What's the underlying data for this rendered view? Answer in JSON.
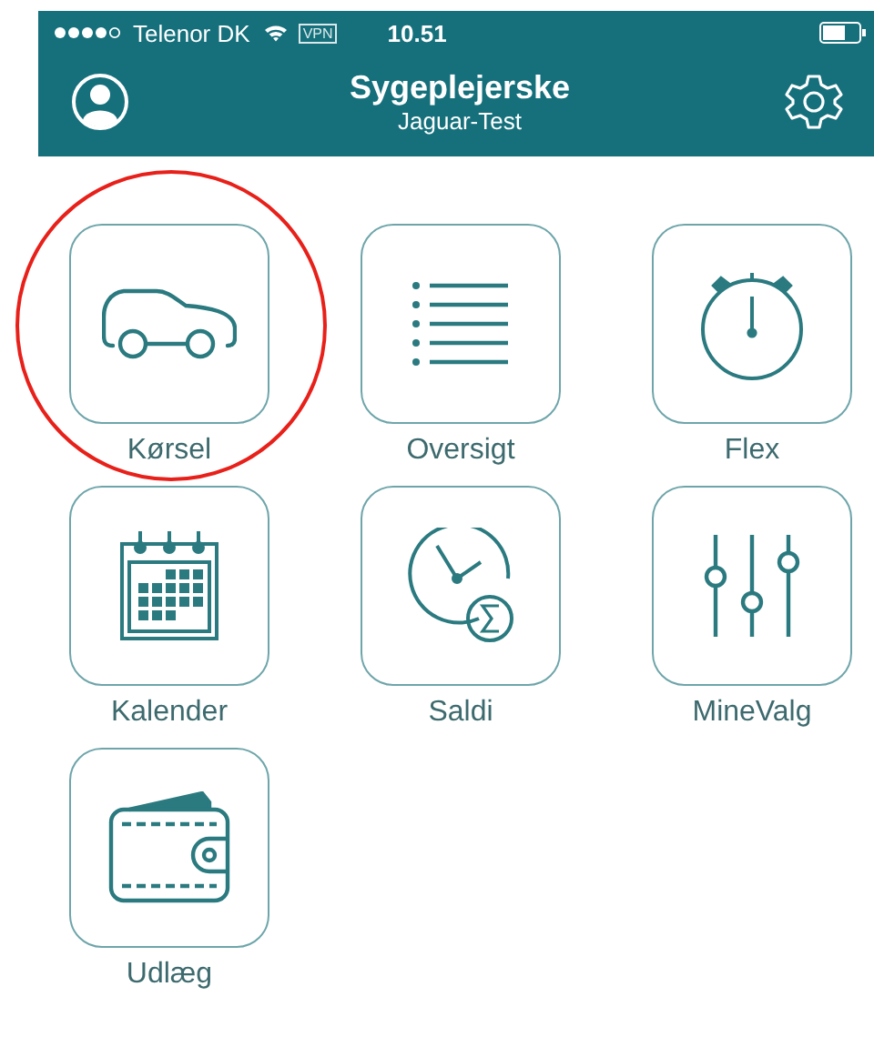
{
  "status_bar": {
    "carrier": "Telenor DK",
    "vpn": "VPN",
    "time": "10.51"
  },
  "nav": {
    "title": "Sygeplejerske",
    "subtitle": "Jaguar-Test"
  },
  "tiles": [
    {
      "label": "Kørsel",
      "kind": "car",
      "highlighted": true
    },
    {
      "label": "Oversigt",
      "kind": "list",
      "highlighted": false
    },
    {
      "label": "Flex",
      "kind": "stopwatch",
      "highlighted": false
    },
    {
      "label": "Kalender",
      "kind": "calendar",
      "highlighted": false
    },
    {
      "label": "Saldi",
      "kind": "clock-sum",
      "highlighted": false
    },
    {
      "label": "MineValg",
      "kind": "sliders",
      "highlighted": false
    },
    {
      "label": "Udlæg",
      "kind": "wallet",
      "highlighted": false
    }
  ]
}
